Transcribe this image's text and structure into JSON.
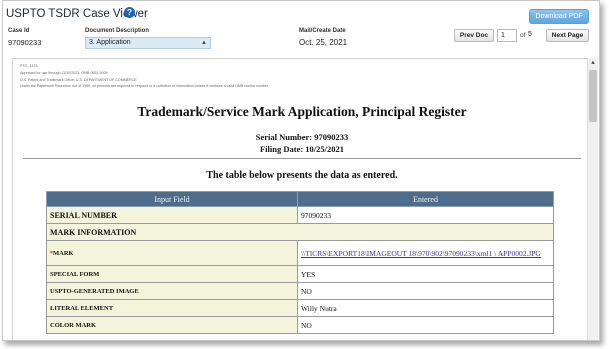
{
  "header": {
    "app_title": "USPTO TSDR Case Viewer",
    "download_label": "Download PDF",
    "case_id_label": "Case Id",
    "case_id_value": "97090233",
    "doc_desc_label": "Document Description",
    "doc_desc_selected": "3. Application",
    "mail_date_label": "Mail/Create Date",
    "mail_date_value": "Oct. 25, 2021",
    "prev_label": "Prev Doc",
    "page_current": "1",
    "page_of": "of",
    "page_total": "5",
    "next_label": "Next Page"
  },
  "document": {
    "fine_print": [
      "PTO- 1478",
      "Approved for use through 11/30/2023. OMB 0651-0009",
      "U.S. Patent and Trademark Office; U.S. DEPARTMENT OF COMMERCE",
      "Under the Paperwork Reduction Act of 1995, no persons are required to respond to a collection of information unless it contains a valid OMB control number"
    ],
    "title": "Trademark/Service Mark Application, Principal Register",
    "serial_line": "Serial Number: 97090233",
    "filing_line": "Filing Date: 10/25/2021",
    "presents_text": "The table below presents the data as entered.",
    "table": {
      "col_input": "Input Field",
      "col_entered": "Entered",
      "required_mark": "*",
      "rows": [
        {
          "field": "SERIAL NUMBER",
          "value": "97090233"
        },
        {
          "field": "MARK INFORMATION",
          "value": ""
        },
        {
          "field": "MARK",
          "value": "\\\\TICRS\\EXPORT18\\IMAGEOUT 18\\970\\902\\97090233\\xml1 \\ APP0002.JPG"
        },
        {
          "field": "SPECIAL FORM",
          "value": "YES"
        },
        {
          "field": "USPTO-GENERATED IMAGE",
          "value": "NO"
        },
        {
          "field": "LITERAL ELEMENT",
          "value": "Willy Nutra"
        },
        {
          "field": "COLOR MARK",
          "value": "NO"
        }
      ]
    }
  },
  "colors": {
    "table_header_bg": "#4e6c8c",
    "field_cell_bg": "#f4f4dc",
    "download_button": "#6aaee0",
    "help_icon": "#1e63b8"
  }
}
